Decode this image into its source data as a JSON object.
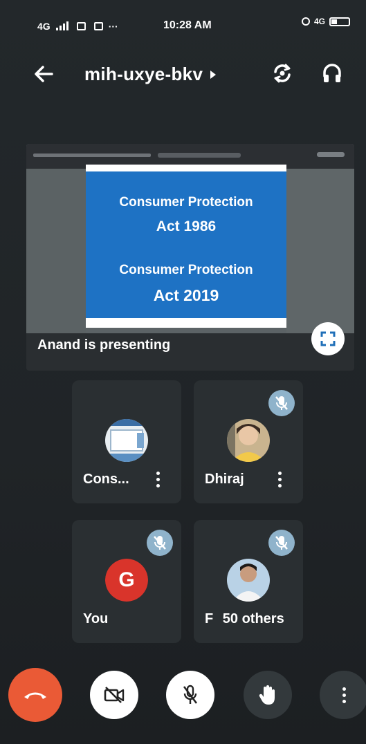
{
  "status_bar": {
    "network": "4G",
    "time": "10:28 AM",
    "network_right": "4G",
    "more": "···"
  },
  "header": {
    "meeting_code": "mih-uxye-bkv"
  },
  "presentation": {
    "slide_lines": [
      "Consumer Protection",
      "Act 1986",
      "Consumer Protection",
      "Act 2019"
    ],
    "presenting_label": "Anand is presenting"
  },
  "participants": [
    {
      "name": "Cons...",
      "avatar": "thumbnail",
      "muted": false
    },
    {
      "name": "Dhiraj",
      "avatar": "photo",
      "muted": true
    },
    {
      "name": "You",
      "avatar_letter": "G",
      "muted": true
    },
    {
      "name": "F",
      "extra": "50 others",
      "avatar": "photo",
      "muted": true
    }
  ],
  "colors": {
    "background": "#1f2326",
    "tile": "#2a2f32",
    "slide_blue": "#1e72c4",
    "end_call": "#ea5a36",
    "mute_badge": "#8fb3cb",
    "avatar_red": "#d9342b"
  },
  "icons": {
    "back": "back-arrow-icon",
    "switch_camera": "switch-camera-icon",
    "audio": "headphones-icon",
    "fullscreen": "fullscreen-icon",
    "mute": "mic-off-icon",
    "end_call": "phone-hangup-icon",
    "camera_off": "video-off-icon",
    "mic_off": "mic-off-icon",
    "raise_hand": "hand-icon",
    "more": "more-vertical-icon"
  }
}
